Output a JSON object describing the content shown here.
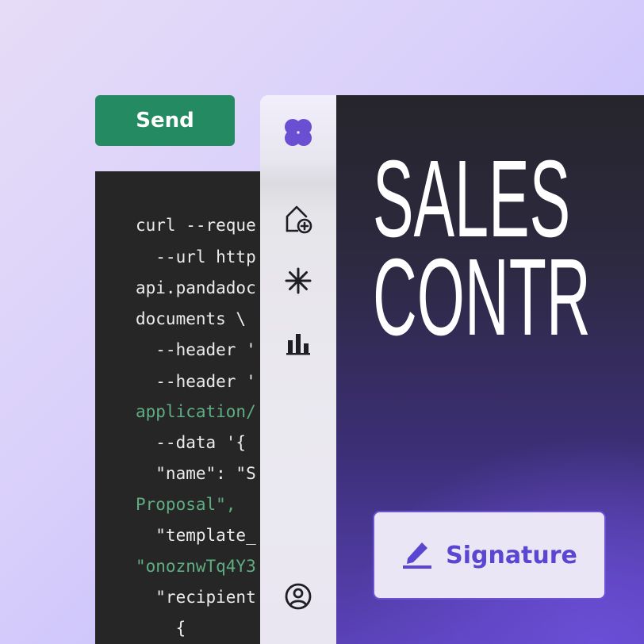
{
  "toolbar": {
    "send_label": "Send"
  },
  "code": {
    "lines": [
      "curl --reque",
      "  --url http",
      "api.pandadoc",
      "documents \\",
      "  --header '",
      "  --header '",
      "application/",
      "  --data '{",
      "  \"name\": \"S",
      "Proposal\",",
      "  \"template_",
      "\"onoznwTq4Y3",
      "  \"recipient",
      "    {"
    ]
  },
  "sidebar": {
    "items": [
      {
        "icon": "clover-logo-icon"
      },
      {
        "icon": "home-add-icon"
      },
      {
        "icon": "asterisk-icon"
      },
      {
        "icon": "bar-chart-icon"
      },
      {
        "icon": "user-account-icon"
      }
    ]
  },
  "hero": {
    "title_line1": "SALES",
    "title_line2": "CONTR",
    "signature_label": "Signature"
  },
  "colors": {
    "send_button": "#238a62",
    "code_bg": "#262626",
    "code_string": "#5fae82",
    "brand_purple": "#6b52d6",
    "signature_text": "#5a46d0"
  }
}
